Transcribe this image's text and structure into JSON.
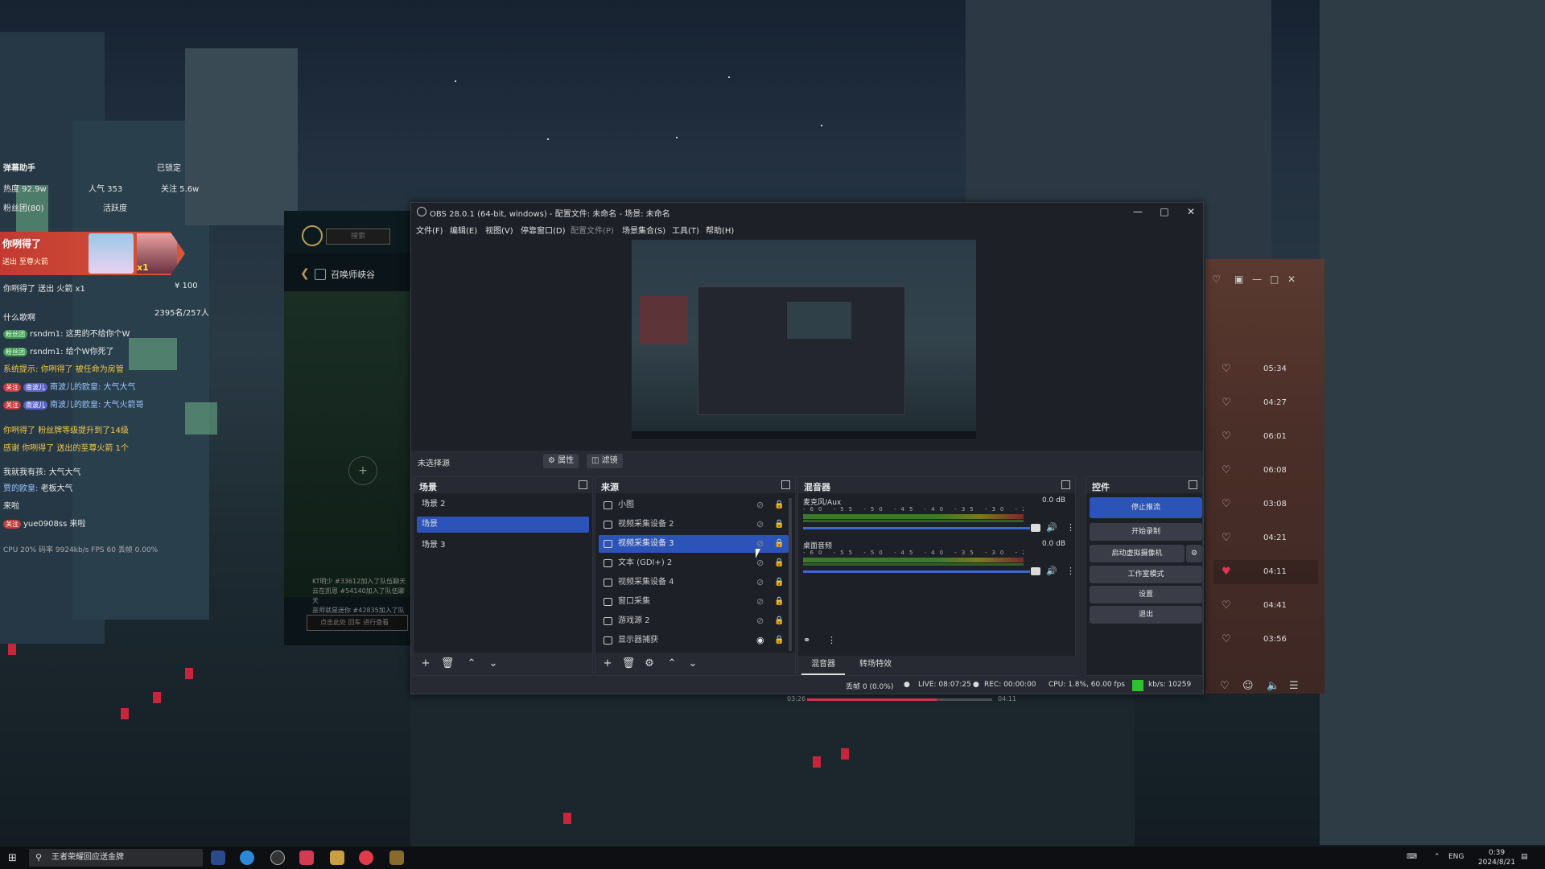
{
  "chat_overlay": {
    "header_left": "弹幕助手",
    "locked": "已锁定",
    "hot": "热度 92.9w",
    "popularity": "人气 353",
    "follow": "关注 5.6w",
    "fans": "粉丝团(80)",
    "events": "活跃度",
    "gift_title": "你咧得了",
    "gift_sub": "送出  至尊火箭",
    "gift_count": "x1",
    "line_gift": "你咧得了 送出 火箭 x1",
    "counter": "¥ 100",
    "stats": "2395名/257人",
    "what": "什么歌啊",
    "messages": [
      {
        "tag": "粉丝团",
        "user": "rsndm1:",
        "text": "这男的不给你个W"
      },
      {
        "tag": "粉丝团",
        "user": "rsndm1:",
        "text": "给个W你死了"
      },
      {
        "tag": "",
        "user": "系统提示:",
        "text": "你咧得了 被任命为房管"
      },
      {
        "tag": "关注",
        "user": "南波儿",
        "text": "南波儿的欧皇: 大气大气"
      },
      {
        "tag": "关注",
        "user": "南波儿",
        "text": "南波儿的欧皇: 大气火箭哥"
      },
      {
        "tag": "",
        "user": "你咧得了",
        "text": "粉丝牌等级提升到了14级"
      },
      {
        "tag": "",
        "user": "感谢",
        "text": "你咧得了 送出的至尊火箭 1个"
      },
      {
        "tag": "",
        "user": "我就我有孩:",
        "text": "大气大气"
      },
      {
        "tag": "",
        "user": "贾的欧皇:",
        "text": "老板大气"
      },
      {
        "tag": "",
        "user": "",
        "text": "来啦"
      },
      {
        "tag": "关注",
        "user": "yue0908ss",
        "text": "来啦"
      }
    ],
    "perf": "CPU 20%   码率 9924kb/s  FPS 60        丢帧 0.00%"
  },
  "lol_client": {
    "search_placeholder": "搜索",
    "back_icon": "back-arrow-icon",
    "title": "召唤师峡谷",
    "plus": "+",
    "chat_lines": [
      "KT明少 #33612加入了队伍聊天",
      "云在凯恩 #54140加入了队伍聊天",
      "巫师就是迷你 #42835加入了队伍聊天"
    ],
    "chat_input": "点击此处 回车 进行查看"
  },
  "music_player": {
    "tracks": [
      {
        "dur": "05:34",
        "liked": false
      },
      {
        "dur": "04:27",
        "liked": false
      },
      {
        "dur": "06:01",
        "liked": false
      },
      {
        "dur": "06:08",
        "liked": false
      },
      {
        "dur": "03:08",
        "liked": false
      },
      {
        "dur": "04:21",
        "liked": false
      },
      {
        "dur": "04:11",
        "liked": true
      },
      {
        "dur": "04:41",
        "liked": false
      },
      {
        "dur": "03:56",
        "liked": false
      }
    ],
    "progress_time": "03:26",
    "total_time": "04:11"
  },
  "obs": {
    "title": "OBS 28.0.1 (64-bit, windows) - 配置文件: 未命名 - 场景: 未命名",
    "menu": [
      "文件(F)",
      "编辑(E)",
      "视图(V)",
      "停靠窗口(D)",
      "配置文件(P)",
      "场景集合(S)",
      "工具(T)",
      "帮助(H)"
    ],
    "no_source": "未选择源",
    "properties": "属性",
    "filters": "滤镜",
    "scenes": {
      "title": "场景",
      "items": [
        "场景 2",
        "场景",
        "场景 3"
      ],
      "selected": 1
    },
    "sources": {
      "title": "来源",
      "items": [
        "小图",
        "视频采集设备 2",
        "视频采集设备 3",
        "文本 (GDI+) 2",
        "视频采集设备 4",
        "窗口采集",
        "游戏源 2",
        "显示器捕获"
      ],
      "selected": 2
    },
    "mixer": {
      "title": "混音器",
      "channels": [
        {
          "name": "麦克风/Aux",
          "db": "0.0 dB"
        },
        {
          "name": "桌面音频",
          "db": "0.0 dB"
        }
      ],
      "scale": "-60 -55 -50 -45 -40 -35 -30 -25 -20 -15 -10 -5 0",
      "tabs": [
        "混音器",
        "转场特效"
      ]
    },
    "controls": {
      "title": "控件",
      "stop_stream": "停止推流",
      "start_record": "开始录制",
      "virtual_cam": "启动虚拟摄像机",
      "studio_mode": "工作室模式",
      "settings": "设置",
      "exit": "退出"
    },
    "status": {
      "dropped": "丢帧 0 (0.0%)",
      "live": "LIVE: 08:07:25",
      "rec": "REC: 00:00:00",
      "cpu": "CPU: 1.8%, 60.00 fps",
      "kbps": "kb/s: 10259",
      "indicator_color": "#2ec22e"
    }
  },
  "taskbar": {
    "search_text": "王者荣耀回应送金牌",
    "lang": "ENG",
    "time": "0:39",
    "date": "2024/8/21"
  }
}
